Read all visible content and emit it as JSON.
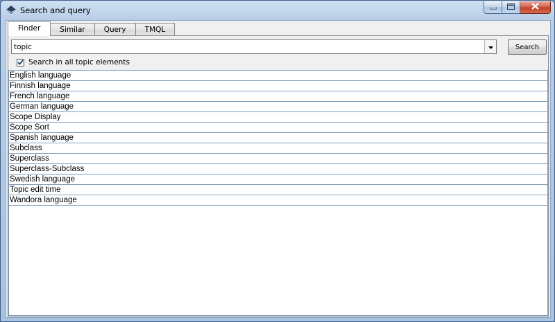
{
  "window": {
    "title": "Search and query"
  },
  "tabs": [
    {
      "label": "Finder",
      "active": true
    },
    {
      "label": "Similar",
      "active": false
    },
    {
      "label": "Query",
      "active": false
    },
    {
      "label": "TMQL",
      "active": false
    }
  ],
  "search": {
    "value": "topic",
    "button_label": "Search"
  },
  "options": {
    "search_all_label": "Search in all topic elements",
    "search_all_checked": true
  },
  "results": [
    "English language",
    "Finnish language",
    "French language",
    "German language",
    "Scope Display",
    "Scope Sort",
    "Spanish language",
    "Subclass",
    "Superclass",
    "Superclass-Subclass",
    "Swedish language",
    "Topic edit time",
    "Wandora language"
  ],
  "icons": {
    "app": "wandora-app-icon",
    "minimize": "minimize-icon",
    "maximize": "maximize-icon",
    "close": "close-icon",
    "dropdown": "chevron-down-icon",
    "check": "checkmark-icon"
  },
  "colors": {
    "close_button": "#c23e24",
    "border_accent": "#7f9db9"
  }
}
